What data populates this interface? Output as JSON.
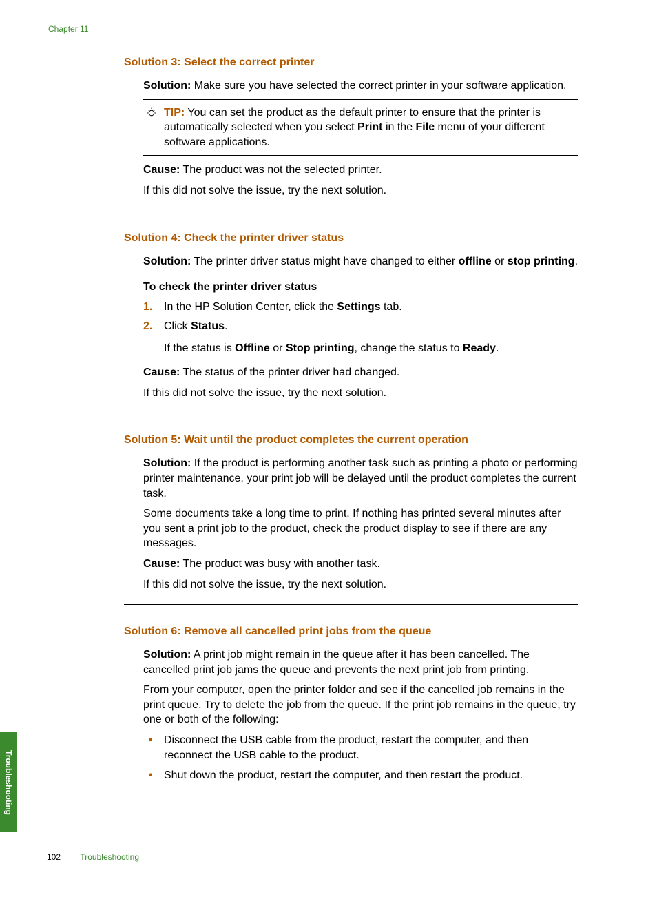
{
  "chapter": "Chapter 11",
  "sideTab": "Troubleshooting",
  "footer": {
    "page": "102",
    "title": "Troubleshooting"
  },
  "sec3": {
    "heading": "Solution 3: Select the correct printer",
    "solLabel": "Solution:",
    "solText": " Make sure you have selected the correct printer in your software application.",
    "tipLabel": "TIP:",
    "tipA": " You can set the product as the default printer to ensure that the printer is automatically selected when you select ",
    "tipPrint": "Print",
    "tipB": " in the ",
    "tipFile": "File",
    "tipC": " menu of your different software applications.",
    "causeLabel": "Cause:",
    "causeText": " The product was not the selected printer.",
    "ifNot": "If this did not solve the issue, try the next solution."
  },
  "sec4": {
    "heading": "Solution 4: Check the printer driver status",
    "solLabel": "Solution:",
    "solA": " The printer driver status might have changed to either ",
    "offline": "offline",
    "solB": " or ",
    "stopPrinting": "stop printing",
    "solC": ".",
    "subhead": "To check the printer driver status",
    "step1a": "In the HP Solution Center, click the ",
    "settings": "Settings",
    "step1b": " tab.",
    "step2a": "Click ",
    "status": "Status",
    "step2b": ".",
    "step2c": "If the status is ",
    "offline2": "Offline",
    "step2d": " or ",
    "stop2": "Stop printing",
    "step2e": ", change the status to ",
    "ready": "Ready",
    "step2f": ".",
    "causeLabel": "Cause:",
    "causeText": " The status of the printer driver had changed.",
    "ifNot": "If this did not solve the issue, try the next solution."
  },
  "sec5": {
    "heading": "Solution 5: Wait until the product completes the current operation",
    "solLabel": "Solution:",
    "solText": " If the product is performing another task such as printing a photo or performing printer maintenance, your print job will be delayed until the product completes the current task.",
    "para2": "Some documents take a long time to print. If nothing has printed several minutes after you sent a print job to the product, check the product display to see if there are any messages.",
    "causeLabel": "Cause:",
    "causeText": " The product was busy with another task.",
    "ifNot": "If this did not solve the issue, try the next solution."
  },
  "sec6": {
    "heading": "Solution 6: Remove all cancelled print jobs from the queue",
    "solLabel": "Solution:",
    "solText": " A print job might remain in the queue after it has been cancelled. The cancelled print job jams the queue and prevents the next print job from printing.",
    "para2": "From your computer, open the printer folder and see if the cancelled job remains in the print queue. Try to delete the job from the queue. If the print job remains in the queue, try one or both of the following:",
    "bullet1": "Disconnect the USB cable from the product, restart the computer, and then reconnect the USB cable to the product.",
    "bullet2": "Shut down the product, restart the computer, and then restart the product."
  }
}
